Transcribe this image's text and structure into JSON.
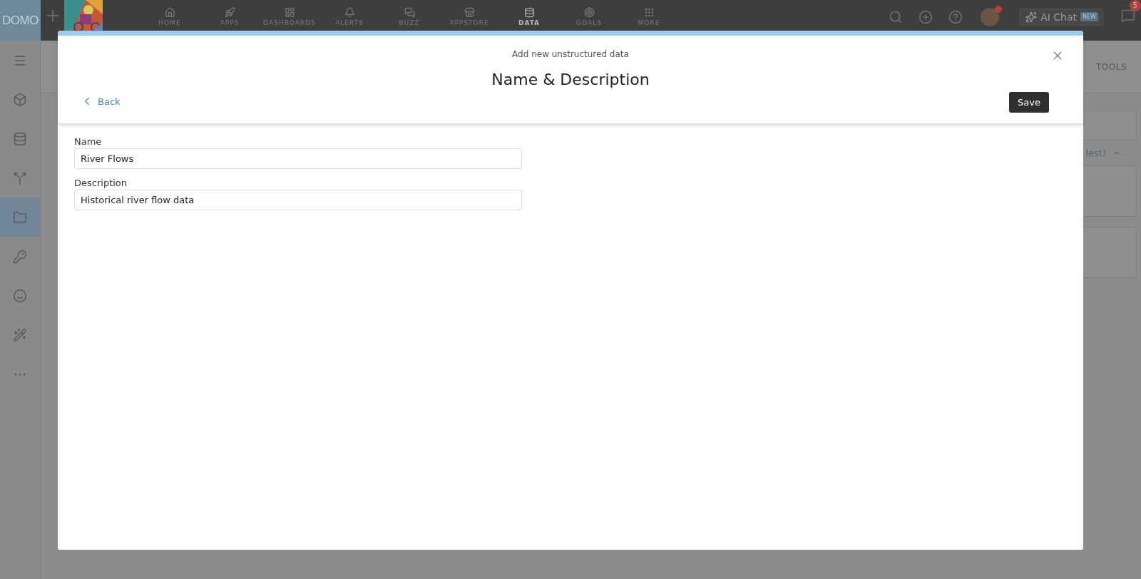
{
  "top_bar": {
    "logo": "DOMO",
    "nav": [
      {
        "label": "HOME",
        "selected": false
      },
      {
        "label": "APPS",
        "selected": false
      },
      {
        "label": "DASHBOARDS",
        "selected": false
      },
      {
        "label": "ALERTS",
        "selected": false
      },
      {
        "label": "BUZZ",
        "selected": false
      },
      {
        "label": "APPSTORE",
        "selected": false
      },
      {
        "label": "DATA",
        "selected": true
      },
      {
        "label": "GOALS",
        "selected": false
      },
      {
        "label": "MORE",
        "selected": false
      }
    ],
    "ai_chat": {
      "label": "AI Chat",
      "badge": "NEW"
    },
    "messages_badge": "5"
  },
  "sidebar": {
    "items": [
      {
        "selected": false
      },
      {
        "selected": false
      },
      {
        "selected": false
      },
      {
        "selected": true
      },
      {
        "selected": false
      },
      {
        "selected": false
      },
      {
        "selected": false
      },
      {
        "selected": false
      }
    ]
  },
  "background": {
    "tab_label": "TOOLS",
    "sort_label": "lest)"
  },
  "modal": {
    "subtitle": "Add new unstructured data",
    "title": "Name & Description",
    "back": "Back",
    "save": "Save",
    "fields": [
      {
        "label": "Name",
        "value": "River Flows"
      },
      {
        "label": "Description",
        "value": "Historical river flow data"
      }
    ]
  }
}
